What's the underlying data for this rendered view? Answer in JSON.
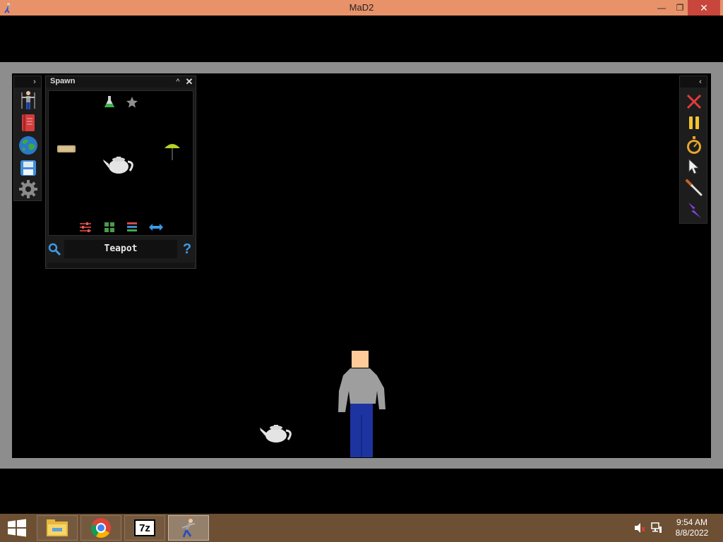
{
  "window": {
    "title": "MaD2",
    "minimize_glyph": "—",
    "maximize_glyph": "❐",
    "close_glyph": "✕"
  },
  "left_toolbar": {
    "expand_glyph": "›",
    "tools": [
      {
        "name": "human-icon"
      },
      {
        "name": "notebook-icon"
      },
      {
        "name": "globe-icon"
      },
      {
        "name": "save-disk-icon"
      },
      {
        "name": "settings-gear-icon"
      }
    ]
  },
  "spawn_panel": {
    "title": "Spawn",
    "collapse_glyph": "^",
    "close_glyph": "✕",
    "items": [
      {
        "name": "flask-icon"
      },
      {
        "name": "star-icon"
      },
      {
        "name": "bread-icon"
      },
      {
        "name": "teapot-icon"
      },
      {
        "name": "umbrella-icon"
      }
    ],
    "controls": [
      {
        "name": "sliders-icon"
      },
      {
        "name": "grid-icon"
      },
      {
        "name": "list-icon"
      },
      {
        "name": "swap-arrows-icon"
      }
    ],
    "selected_item": "Teapot",
    "help_glyph": "?"
  },
  "right_toolbar": {
    "collapse_glyph": "‹",
    "tools": [
      {
        "name": "delete-x-icon"
      },
      {
        "name": "pause-icon"
      },
      {
        "name": "stopwatch-icon"
      },
      {
        "name": "cursor-icon"
      },
      {
        "name": "knife-icon"
      },
      {
        "name": "lightning-icon"
      }
    ]
  },
  "scene": {
    "objects": [
      "teapot",
      "ragdoll"
    ]
  },
  "taskbar": {
    "apps": [
      {
        "name": "file-explorer-icon"
      },
      {
        "name": "chrome-icon"
      },
      {
        "name": "7zip-icon",
        "label": "7z"
      },
      {
        "name": "mad2-app-icon"
      }
    ],
    "tray": [
      {
        "name": "volume-muted-icon"
      },
      {
        "name": "network-icon"
      }
    ],
    "time": "9:54 AM",
    "date": "8/8/2022"
  },
  "colors": {
    "titlebar": "#e8926a",
    "close_button": "#c9463d",
    "taskbar": "#6d4f33",
    "viewport_border": "#8d8d8d",
    "accent_blue": "#3c9be6"
  }
}
